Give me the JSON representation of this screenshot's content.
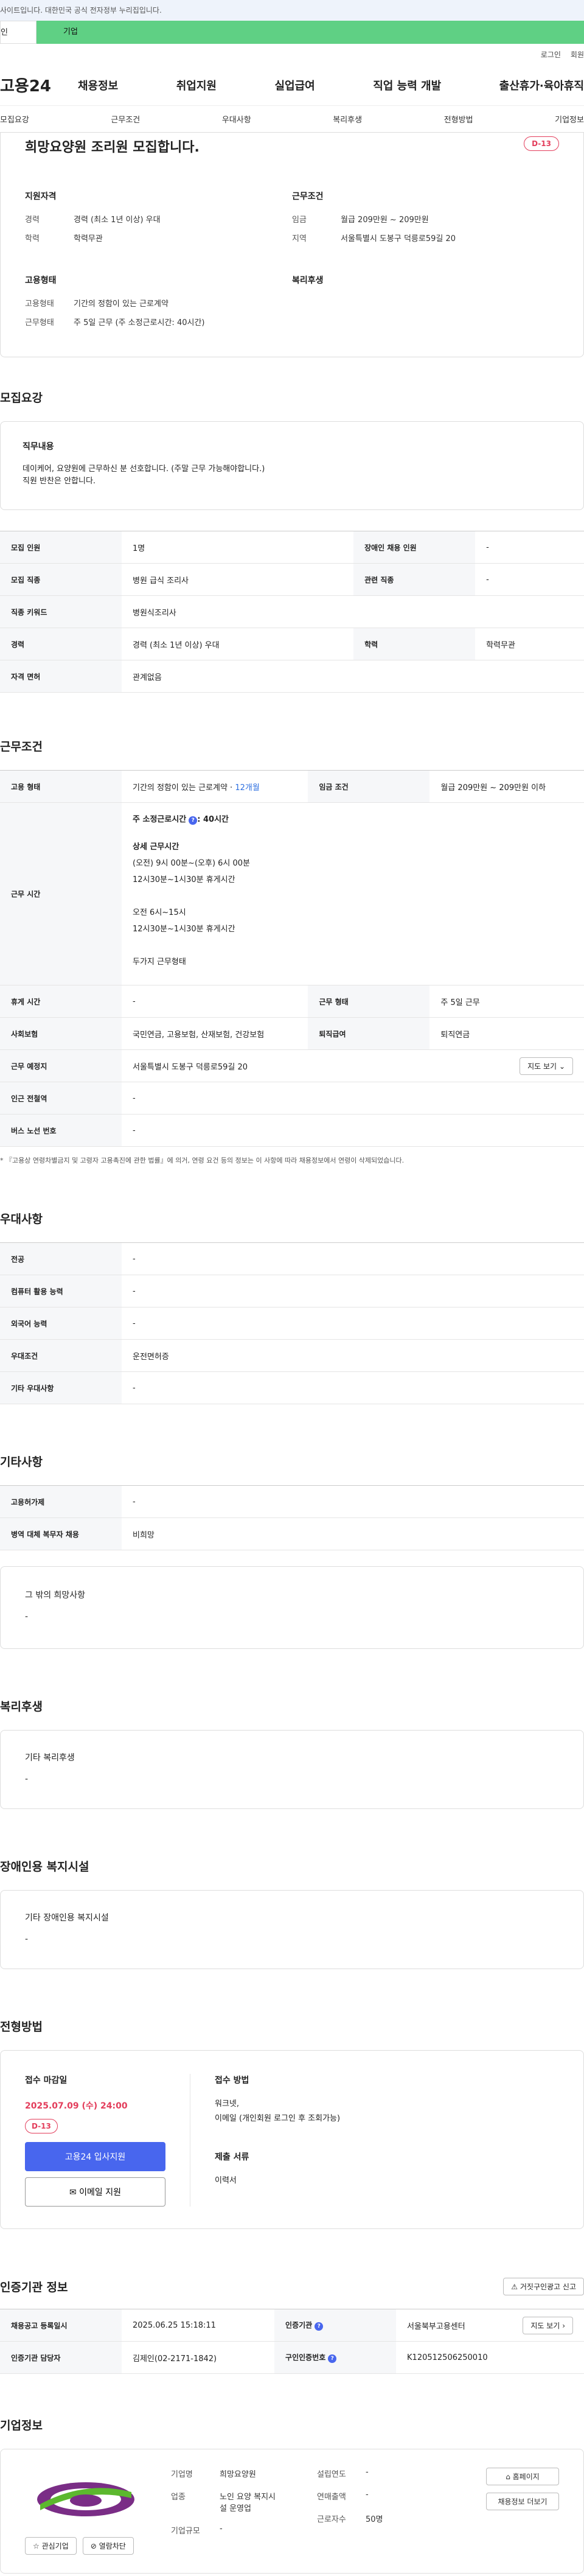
{
  "banner": {
    "text": "사이트입니다. 대한민국 공식 전자정부 누리집입니다."
  },
  "top_tabs": {
    "personal": "인",
    "company": "기업"
  },
  "util": {
    "login": "로그인",
    "signup": "회원"
  },
  "gnb": {
    "logo": "고용24",
    "menu": [
      "채용정보",
      "취업지원",
      "실업급여",
      "직업 능력 개발",
      "출산휴가·육아휴직"
    ]
  },
  "subnav": [
    "모집요강",
    "근무조건",
    "우대사항",
    "복리후생",
    "전형방법",
    "기업정보"
  ],
  "job": {
    "title": "희망요양원 조리원 모집합니다.",
    "dday": "D-13",
    "qual_title": "지원자격",
    "career_k": "경력",
    "career_v": "경력 (최소 1년 이상) 우대",
    "edu_k": "학력",
    "edu_v": "학력무관",
    "cond_title": "근무조건",
    "wage_k": "임금",
    "wage_v": "월급 209만원 ~ 209만원",
    "region_k": "지역",
    "region_v": "서울특별시 도봉구 덕릉로59길 20",
    "emp_title": "고용형태",
    "emp_k": "고용형태",
    "emp_v": "기간의 정함이 있는 근로계약",
    "work_k": "근무형태",
    "work_v": "주 5일 근무 (주 소정근로시간: 40시간)",
    "welfare_title": "복리후생"
  },
  "recruit": {
    "title": "모집요강",
    "duty_title": "직무내용",
    "duty_line1": "데이케어, 요양원에 근무하신 분 선호합니다. (주말 근무 가능해야합니다.)",
    "duty_line2": "직원 반찬은 안합니다.",
    "rows": {
      "count_k": "모집 인원",
      "count_v": "1명",
      "disab_k": "장애인 채용 인원",
      "disab_v": "-",
      "job_k": "모집 직종",
      "job_v": "병원 급식 조리사",
      "rel_k": "관련 직종",
      "rel_v": "-",
      "kw_k": "직종 키워드",
      "kw_v": "병원식조리사",
      "career_k": "경력",
      "career_v": "경력 (최소 1년 이상) 우대",
      "edu_k": "학력",
      "edu_v": "학력무관",
      "license_k": "자격 면허",
      "license_v": "관계없음"
    }
  },
  "conditions": {
    "title": "근무조건",
    "emp_k": "고용 형태",
    "emp_v": "기간의 정함이 있는 근로계약 · ",
    "emp_months": "12개월",
    "wage_k": "임금 조건",
    "wage_v": "월급 209만원 ~ 209만원 이하",
    "hours_k": "근무 시간",
    "hours_weekly": "주 소정근로시간",
    "hours_weekly_v": ": 40시간",
    "hours_detail_title": "상세 근무시간",
    "hours_lines": [
      "(오전) 9시 00분~(오후) 6시 00분",
      "12시30분~1시30분 휴게시간",
      "",
      "오전 6시~15시",
      "12시30분~1시30분 휴게시간",
      "",
      "두가지 근무형태"
    ],
    "rest_k": "휴게 시간",
    "rest_v": "-",
    "worktype_k": "근무 형태",
    "worktype_v": "주 5일 근무",
    "insurance_k": "사회보험",
    "insurance_v": "국민연금, 고용보험, 산재보험, 건강보험",
    "retire_k": "퇴직급여",
    "retire_v": "퇴직연금",
    "place_k": "근무 예정지",
    "place_v": "서울특별시 도봉구 덕릉로59길 20",
    "map_btn": "지도 보기",
    "subway_k": "인근 전철역",
    "subway_v": "-",
    "bus_k": "버스 노선 번호",
    "bus_v": "-",
    "note": "* 『고용상 연령차별금지 및 고령자 고용촉진에 관한 법률』에 의거, 연령 요건 등의 정보는 이 사항에 따라 채용정보에서 연령이 삭제되었습니다."
  },
  "preference": {
    "title": "우대사항",
    "major_k": "전공",
    "major_v": "-",
    "computer_k": "컴퓨터 활용 능력",
    "computer_v": "-",
    "lang_k": "외국어 능력",
    "lang_v": "-",
    "cond_k": "우대조건",
    "cond_v": "운전면허증",
    "etc_k": "기타 우대사항",
    "etc_v": "-"
  },
  "others": {
    "title": "기타사항",
    "employ_k": "고용허가제",
    "employ_v": "-",
    "military_k": "병역 대체 복무자 채용",
    "military_v": "비희망",
    "misc_title": "그 밖의 희망사항",
    "misc_v": "-"
  },
  "welfare": {
    "title": "복리후생",
    "card_title": "기타 복리후생",
    "card_v": "-"
  },
  "disability": {
    "title": "장애인용 복지시설",
    "card_title": "기타 장애인용 복지시설",
    "card_v": "-"
  },
  "apply": {
    "title": "전형방법",
    "deadline_title": "접수 마감일",
    "deadline": "2025.07.09 (수) 24:00",
    "dday": "D-13",
    "btn_apply": "고용24 입사지원",
    "btn_email": "이메일 지원",
    "method_title": "접수 방법",
    "method_v1": "워크넷,",
    "method_v2": "이메일 (개인회원 로그인 후 조회가능)",
    "docs_title": "제출 서류",
    "docs_v": "이력서"
  },
  "cert": {
    "title": "인증기관 정보",
    "report_btn": "거짓구인광고 신고",
    "reg_k": "채용공고 등록일시",
    "reg_v": "2025.06.25 15:18:11",
    "org_k": "인증기관",
    "org_v": "서울북부고용센터",
    "manager_k": "인증기관 담당자",
    "manager_v": "김제인(02-2171-1842)",
    "num_k": "구인인증번호",
    "num_v": "K120512506250010",
    "map_btn": "지도 보기"
  },
  "company": {
    "title": "기업정보",
    "name_k": "기업명",
    "name_v": "희망요양원",
    "year_k": "설립연도",
    "year_v": "-",
    "industry_k": "업종",
    "industry_v1": "노인 요양 복지시",
    "industry_v2": "설 운영업",
    "sales_k": "연매출액",
    "sales_v": "-",
    "staff_k": "근로자수",
    "staff_v": "50명",
    "size_k": "기업규모",
    "size_v": "-",
    "btn_home": "홈페이지",
    "btn_jobs": "채용정보 더보기",
    "btn_fav": "관심기업",
    "btn_block": "열람차단"
  }
}
